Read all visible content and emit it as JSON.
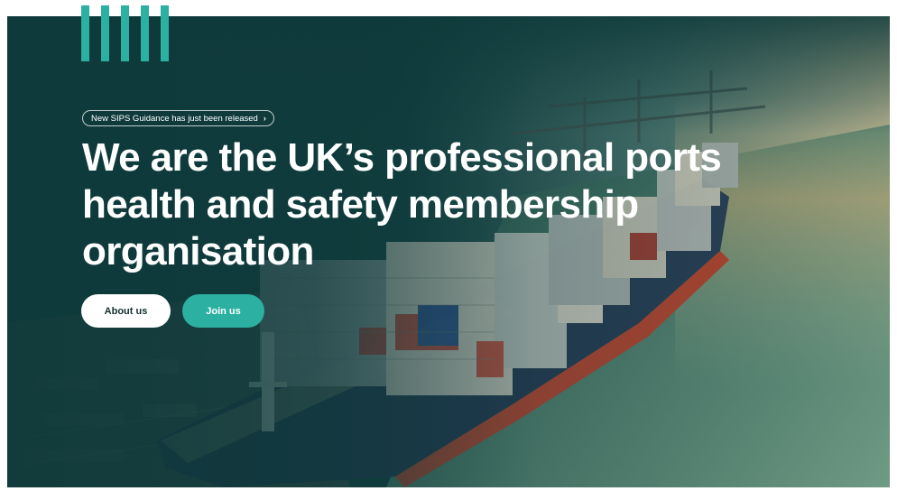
{
  "announcement": {
    "text": "New SIPS Guidance has just been released",
    "icon": "chevron-right-icon"
  },
  "hero": {
    "headline": "We are the UK’s professional ports health and safety membership organisation"
  },
  "buttons": {
    "about_label": "About us",
    "join_label": "Join us"
  },
  "colors": {
    "primary_dark": "#0f3a3b",
    "accent_teal": "#2bb0a2",
    "white": "#ffffff"
  }
}
